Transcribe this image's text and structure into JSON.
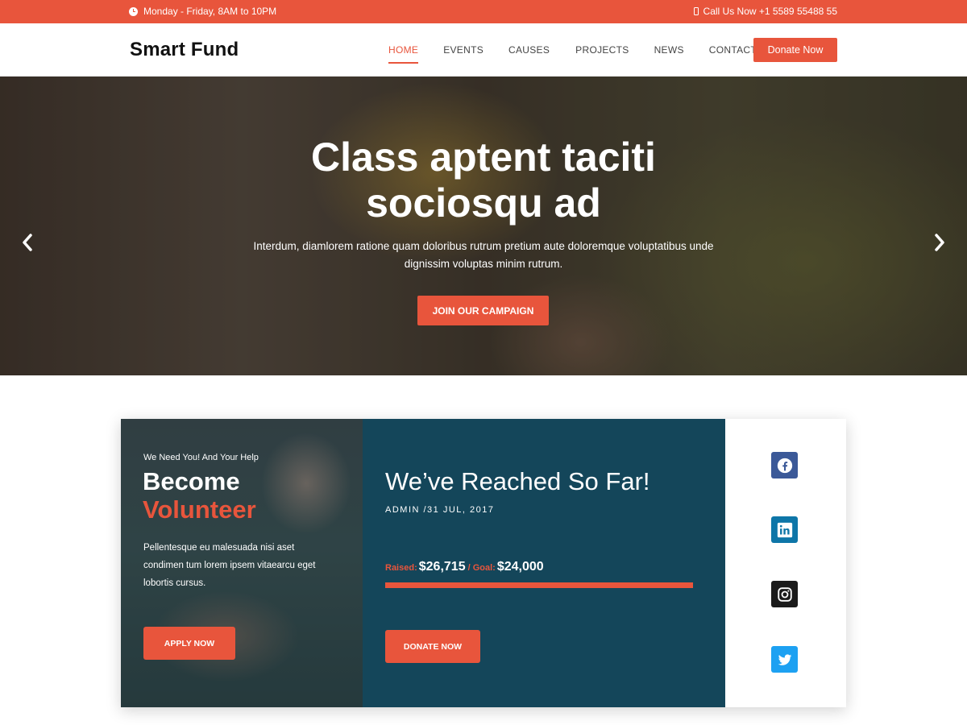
{
  "topbar": {
    "hours": "Monday - Friday, 8AM to 10PM",
    "phone": "Call Us Now +1 5589 55488 55"
  },
  "header": {
    "logo": "Smart Fund",
    "nav": [
      "HOME",
      "EVENTS",
      "CAUSES",
      "PROJECTS",
      "NEWS",
      "CONTACT"
    ],
    "active_nav": "HOME",
    "donate_label": "Donate Now"
  },
  "hero": {
    "title": "Class aptent taciti sociosqu ad",
    "subtitle": "Interdum, diamlorem ratione quam doloribus rutrum pretium aute doloremque voluptatibus unde dignissim voluptas minim rutrum.",
    "cta_label": "JOIN OUR CAMPAIGN",
    "prev_icon": "chevron-left-icon",
    "next_icon": "chevron-right-icon"
  },
  "volunteer": {
    "kicker": "We Need You! And Your Help",
    "title_line1": "Become",
    "title_line2": "Volunteer",
    "description": "Pellentesque eu malesuada nisi aset condimen tum lorem ipsem vitaearcu eget lobortis cursus.",
    "apply_label": "APPLY NOW"
  },
  "reach": {
    "title": "We’ve Reached So Far!",
    "meta": "ADMIN /31 JUL, 2017",
    "raised_label": "Raised:",
    "raised_value": "$26,715",
    "goal_label": "/ Goal:",
    "goal_value": "$24,000",
    "progress_fraction": 1.0,
    "donate_label": "DONATE NOW"
  },
  "social": {
    "icons": [
      "facebook-icon",
      "linkedin-icon",
      "instagram-icon",
      "twitter-icon"
    ]
  },
  "colors": {
    "accent": "#e8553c",
    "navy": "#14465a",
    "facebook": "#3b5998",
    "linkedin": "#0e76a8",
    "instagram": "#1b1b1b",
    "twitter": "#1da1f2"
  }
}
